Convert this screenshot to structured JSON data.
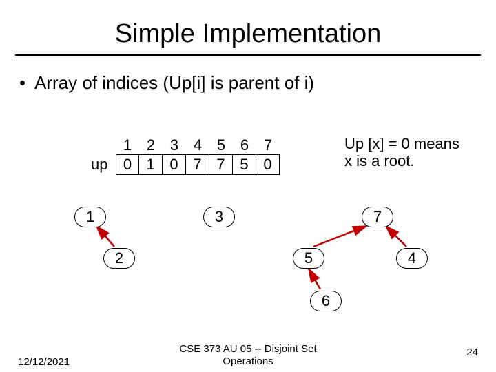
{
  "title": "Simple Implementation",
  "bullet": "Array of indices (Up[i] is parent of i)",
  "array": {
    "label": "up",
    "indices": [
      "1",
      "2",
      "3",
      "4",
      "5",
      "6",
      "7"
    ],
    "values": [
      "0",
      "1",
      "0",
      "7",
      "7",
      "5",
      "0"
    ]
  },
  "note_line1": "Up [x] = 0 means",
  "note_line2": "x is a root.",
  "nodes": {
    "n1": "1",
    "n2": "2",
    "n3": "3",
    "n4": "4",
    "n5": "5",
    "n6": "6",
    "n7": "7"
  },
  "footer": {
    "date": "12/12/2021",
    "course": "CSE 373 AU 05 -- Disjoint Set\nOperations",
    "page": "24"
  }
}
